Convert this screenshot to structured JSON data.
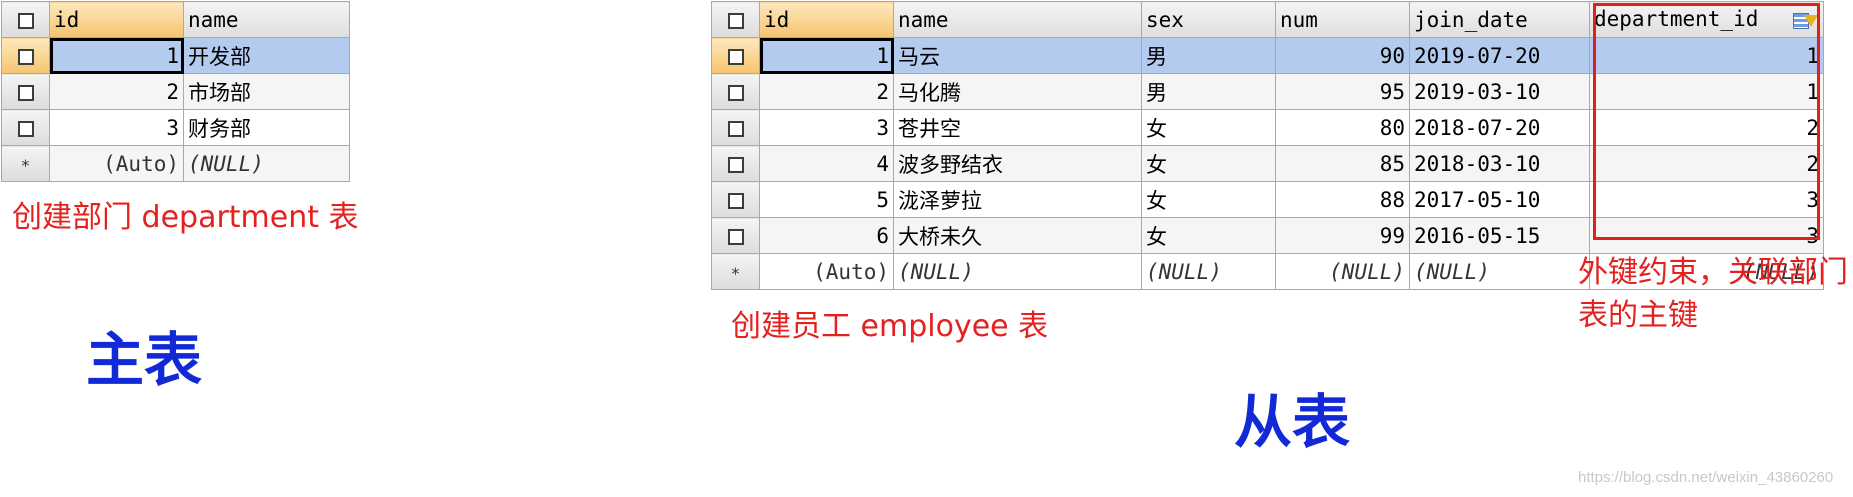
{
  "department_table": {
    "columns": [
      "id",
      "name"
    ],
    "rows": [
      {
        "id": "1",
        "name": "开发部"
      },
      {
        "id": "2",
        "name": "市场部"
      },
      {
        "id": "3",
        "name": "财务部"
      }
    ],
    "new_row": {
      "marker": "*",
      "id": "(Auto)",
      "name": "(NULL)"
    }
  },
  "employee_table": {
    "columns": [
      "id",
      "name",
      "sex",
      "num",
      "join_date",
      "department_id"
    ],
    "rows": [
      {
        "id": "1",
        "name": "马云",
        "sex": "男",
        "num": "90",
        "join_date": "2019-07-20",
        "department_id": "1"
      },
      {
        "id": "2",
        "name": "马化腾",
        "sex": "男",
        "num": "95",
        "join_date": "2019-03-10",
        "department_id": "1"
      },
      {
        "id": "3",
        "name": "苍井空",
        "sex": "女",
        "num": "80",
        "join_date": "2018-07-20",
        "department_id": "2"
      },
      {
        "id": "4",
        "name": "波多野结衣",
        "sex": "女",
        "num": "85",
        "join_date": "2018-03-10",
        "department_id": "2"
      },
      {
        "id": "5",
        "name": "泷泽萝拉",
        "sex": "女",
        "num": "88",
        "join_date": "2017-05-10",
        "department_id": "3"
      },
      {
        "id": "6",
        "name": "大桥未久",
        "sex": "女",
        "num": "99",
        "join_date": "2016-05-15",
        "department_id": "3"
      }
    ],
    "new_row": {
      "marker": "*",
      "id": "(Auto)",
      "name": "(NULL)",
      "sex": "(NULL)",
      "num": "(NULL)",
      "join_date": "(NULL)",
      "department_id": "(NULL)"
    }
  },
  "annotations": {
    "department_caption": "创建部门 department 表",
    "employee_caption": "创建员工 employee 表",
    "master_label": "主表",
    "slave_label": "从表",
    "fk_note": "外键约束，关联部门表的主键",
    "watermark": "https://blog.csdn.net/weixin_43860260"
  },
  "colors": {
    "annotation_red": "#e4211f",
    "label_blue": "#1229d6",
    "selected_row": "#b4cbf0",
    "sorted_header": "#f6c46e"
  }
}
